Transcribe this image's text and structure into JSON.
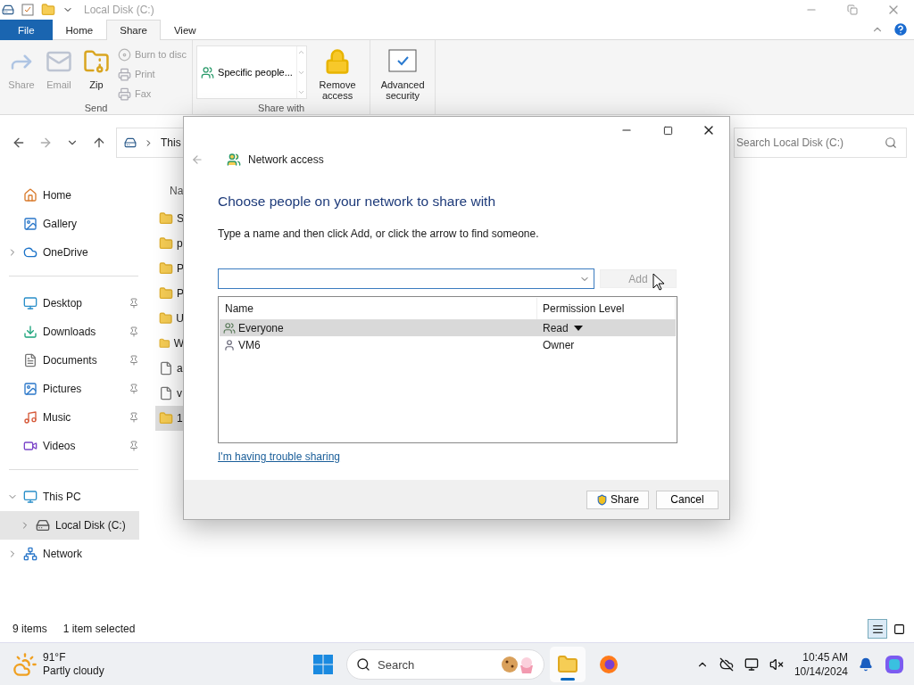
{
  "window": {
    "title": "Local Disk (C:)"
  },
  "ribbon": {
    "tabs": [
      {
        "label": "File",
        "kind": "file",
        "selected": false
      },
      {
        "label": "Home",
        "kind": "tab",
        "selected": false
      },
      {
        "label": "Share",
        "kind": "tab",
        "selected": true
      },
      {
        "label": "View",
        "kind": "tab",
        "selected": false
      }
    ],
    "groups": [
      {
        "label": "Send",
        "items": [
          {
            "label": "Share",
            "kind": "share",
            "disabled": true
          },
          {
            "label": "Email",
            "kind": "email",
            "disabled": true
          },
          {
            "label": "Zip",
            "kind": "zip",
            "disabled": false
          },
          {
            "label": "Burn to disc",
            "kind": "burn",
            "disabled": true
          },
          {
            "label": "Print",
            "kind": "print",
            "disabled": true
          },
          {
            "label": "Fax",
            "kind": "fax",
            "disabled": true
          }
        ]
      },
      {
        "label": "Share with",
        "items": [
          {
            "label": "Specific people...",
            "kind": "gallery"
          },
          {
            "label": "Remove access",
            "kind": "lock",
            "disabled": false
          }
        ]
      },
      {
        "items": [
          {
            "label": "Advanced security",
            "kind": "security",
            "disabled": false
          }
        ]
      }
    ]
  },
  "address": {
    "crumb": "This"
  },
  "search": {
    "placeholder": "Search Local Disk (C:)"
  },
  "sidebar": {
    "sections": [
      {
        "items": [
          {
            "label": "Home",
            "kind": "home",
            "selected": false
          },
          {
            "label": "Gallery",
            "kind": "gallery",
            "selected": false
          },
          {
            "label": "OneDrive",
            "kind": "onedrive",
            "selected": false,
            "expanded": false
          }
        ]
      },
      {
        "items": [
          {
            "label": "Desktop",
            "kind": "desktop",
            "selected": false,
            "pinned": true
          },
          {
            "label": "Downloads",
            "kind": "downloads",
            "selected": false,
            "pinned": true
          },
          {
            "label": "Documents",
            "kind": "documents",
            "selected": false,
            "pinned": true
          },
          {
            "label": "Pictures",
            "kind": "pictures",
            "selected": false,
            "pinned": true
          },
          {
            "label": "Music",
            "kind": "music",
            "selected": false,
            "pinned": true
          },
          {
            "label": "Videos",
            "kind": "videos",
            "selected": false,
            "pinned": true
          }
        ]
      },
      {
        "items": [
          {
            "label": "This PC",
            "kind": "pc",
            "selected": false,
            "expanded": true,
            "children": [
              {
                "label": "Local Disk (C:)",
                "kind": "disk",
                "selected": true,
                "expanded": false
              }
            ]
          },
          {
            "label": "Network",
            "kind": "network",
            "selected": false,
            "expanded": false
          }
        ]
      }
    ]
  },
  "files": {
    "column": "Na",
    "rows": [
      {
        "name": "S",
        "kind": "folder",
        "selected": false
      },
      {
        "name": "p",
        "kind": "folder",
        "selected": false
      },
      {
        "name": "P",
        "kind": "folder",
        "selected": false
      },
      {
        "name": "P",
        "kind": "folder",
        "selected": false
      },
      {
        "name": "U",
        "kind": "folder",
        "selected": false
      },
      {
        "name": "W",
        "kind": "folder",
        "selected": false
      },
      {
        "name": "a",
        "kind": "file",
        "selected": false
      },
      {
        "name": "v",
        "kind": "file",
        "selected": false
      },
      {
        "name": "1",
        "kind": "folder",
        "selected": true
      }
    ]
  },
  "status_bar": {
    "count": "9 items",
    "selection": "1 item selected",
    "views": [
      {
        "kind": "details",
        "selected": true
      },
      {
        "kind": "tiles",
        "selected": false
      }
    ]
  },
  "dialog": {
    "title": "Network access",
    "heading": "Choose people on your network to share with",
    "instruction": "Type a name and then click Add, or click the arrow to find someone.",
    "add_button": {
      "label": "Add",
      "disabled": true
    },
    "table": {
      "columns": [
        "Name",
        "Permission Level"
      ],
      "rows": [
        {
          "name": "Everyone",
          "kind": "group",
          "permission": "Read",
          "selected": true
        },
        {
          "name": "VM6",
          "kind": "user",
          "permission": "Owner",
          "selected": false
        }
      ]
    },
    "link": "I'm having trouble sharing",
    "buttons": [
      {
        "label": "Share",
        "kind": "shield"
      },
      {
        "label": "Cancel",
        "kind": "plain"
      }
    ]
  },
  "taskbar": {
    "weather": {
      "temperature": "91°F",
      "condition": "Partly cloudy"
    },
    "search": {
      "placeholder": "Search"
    },
    "apps": [
      {
        "kind": "explorer",
        "active": true
      },
      {
        "kind": "firefox",
        "active": false
      }
    ],
    "time": "10:45 AM",
    "date": "10/14/2024"
  }
}
